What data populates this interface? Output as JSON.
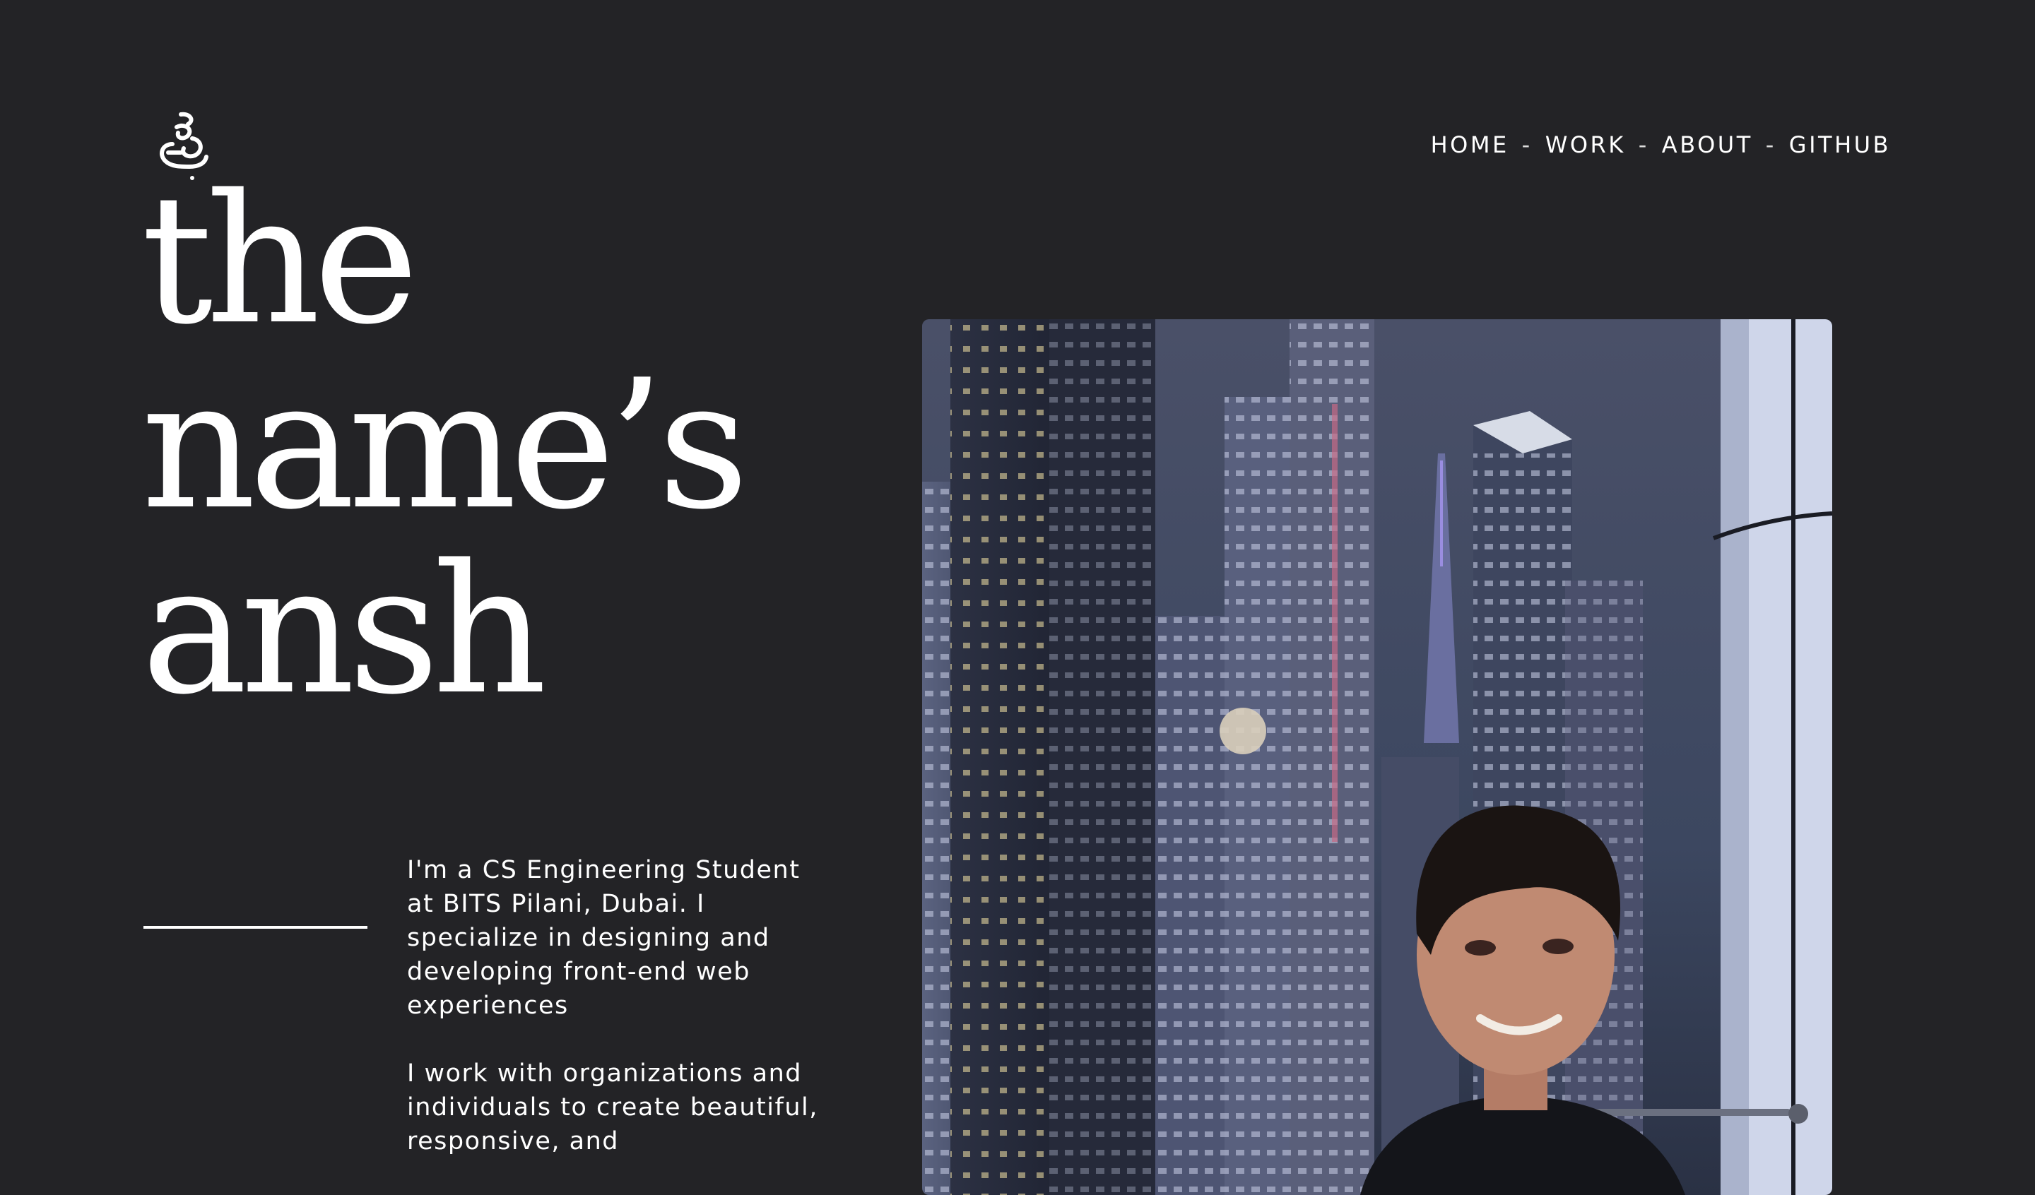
{
  "nav": {
    "items": [
      "HOME",
      "WORK",
      "ABOUT",
      "GITHUB"
    ],
    "separator": "-"
  },
  "hero": {
    "lines": [
      "the",
      "name’s",
      "ansh"
    ]
  },
  "bio": {
    "paragraphs": [
      "I'm a CS Engineering Student at BITS Pilani, Dubai. I specialize in designing and developing front-end web experiences",
      "I work with organizations and individuals to create beautiful, responsive, and"
    ]
  },
  "colors": {
    "background": "#232326",
    "text": "#ffffff",
    "cursor": "#d9cfbb"
  },
  "icons": {
    "logo": "monogram-logo-icon",
    "cursor": "cursor-dot-icon"
  },
  "photo": {
    "subject": "portrait-in-front-of-city-skyline"
  }
}
